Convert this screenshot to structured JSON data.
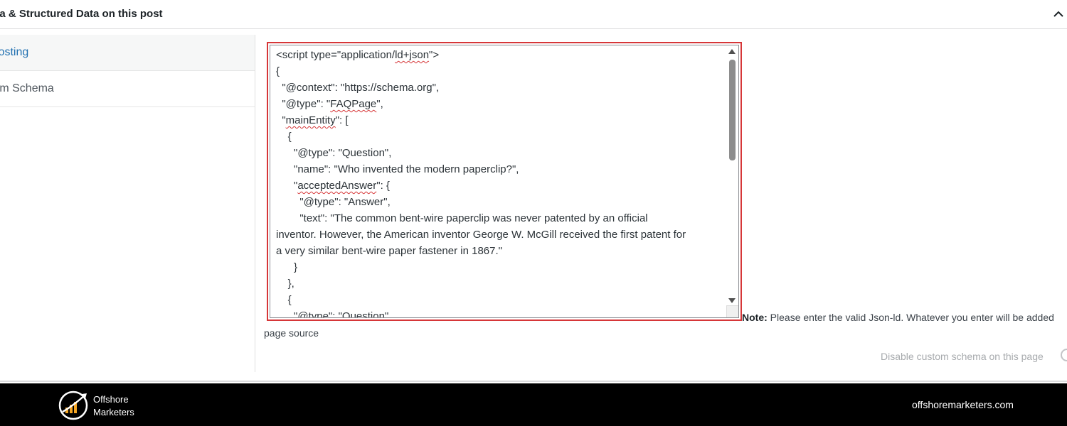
{
  "panel": {
    "title": "ma & Structured Data on this post"
  },
  "sidebar": {
    "items": [
      {
        "label": "gPosting"
      },
      {
        "label": "stom Schema"
      }
    ]
  },
  "editor": {
    "lines": [
      "<script type=\"application/ld+json\">",
      "{",
      "  \"@context\": \"https://schema.org\",",
      "  \"@type\": \"FAQPage\",",
      "  \"mainEntity\": [",
      "    {",
      "      \"@type\": \"Question\",",
      "      \"name\": \"Who invented the modern paperclip?\",",
      "      \"acceptedAnswer\": {",
      "        \"@type\": \"Answer\",",
      "        \"text\": \"The common bent-wire paperclip was never patented by an official",
      "inventor. However, the American inventor George W. McGill received the first patent for",
      "a very similar bent-wire paper fastener in 1867.\"",
      "      }",
      "    },",
      "    {",
      "      \"@type\": \"Question\","
    ]
  },
  "note": {
    "label": "Note:",
    "text": " Please enter the valid Json-ld. Whatever you enter will be added",
    "continuation": "page source"
  },
  "disable_toggle": {
    "label": "Disable custom schema on this page"
  },
  "footer": {
    "brand_line1": "Offshore",
    "brand_line2": "Marketers",
    "site": "offshoremarketers.com"
  }
}
